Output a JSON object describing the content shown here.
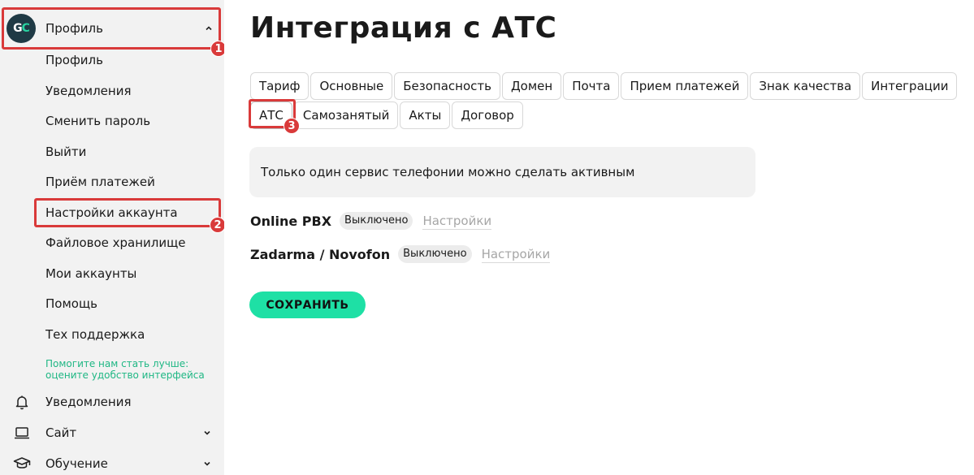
{
  "sidebar": {
    "logo_text_g": "G",
    "logo_text_c": "C",
    "profile_label": "Профиль",
    "profile_items": [
      {
        "label": "Профиль"
      },
      {
        "label": "Уведомления"
      },
      {
        "label": "Сменить пароль"
      },
      {
        "label": "Выйти"
      },
      {
        "label": "Приём платежей"
      },
      {
        "label": "Настройки аккаунта"
      },
      {
        "label": "Файловое хранилище"
      },
      {
        "label": "Мои аккаунты"
      },
      {
        "label": "Помощь"
      },
      {
        "label": "Тех поддержка"
      }
    ],
    "feedback_line1": "Помогите нам стать лучше:",
    "feedback_line2": "оцените удобство интерфейса",
    "nav": [
      {
        "label": "Уведомления",
        "icon": "bell-icon"
      },
      {
        "label": "Сайт",
        "icon": "laptop-icon"
      },
      {
        "label": "Обучение",
        "icon": "graduation-cap-icon"
      }
    ]
  },
  "annotations": [
    "1",
    "2",
    "3"
  ],
  "main": {
    "title": "Интеграция с АТС",
    "tabs_row1": [
      "Тариф",
      "Основные",
      "Безопасность",
      "Домен",
      "Почта",
      "Прием платежей",
      "Знак качества",
      "Интеграции"
    ],
    "tabs_row2": [
      "АТС",
      "Самозанятый",
      "Акты",
      "Договор"
    ],
    "active_tab": "АТС",
    "notice": "Только один сервис телефонии можно сделать активным",
    "services": [
      {
        "name": "Online PBX",
        "status": "Выключено",
        "settings": "Настройки"
      },
      {
        "name": "Zadarma / Novofon",
        "status": "Выключено",
        "settings": "Настройки"
      }
    ],
    "save_label": "СОХРАНИТЬ"
  },
  "colors": {
    "accent": "#1ee0a5",
    "annotation": "#d93a3a",
    "sidebar_bg": "#f2f2f2",
    "feedback_text": "#1fb784"
  }
}
